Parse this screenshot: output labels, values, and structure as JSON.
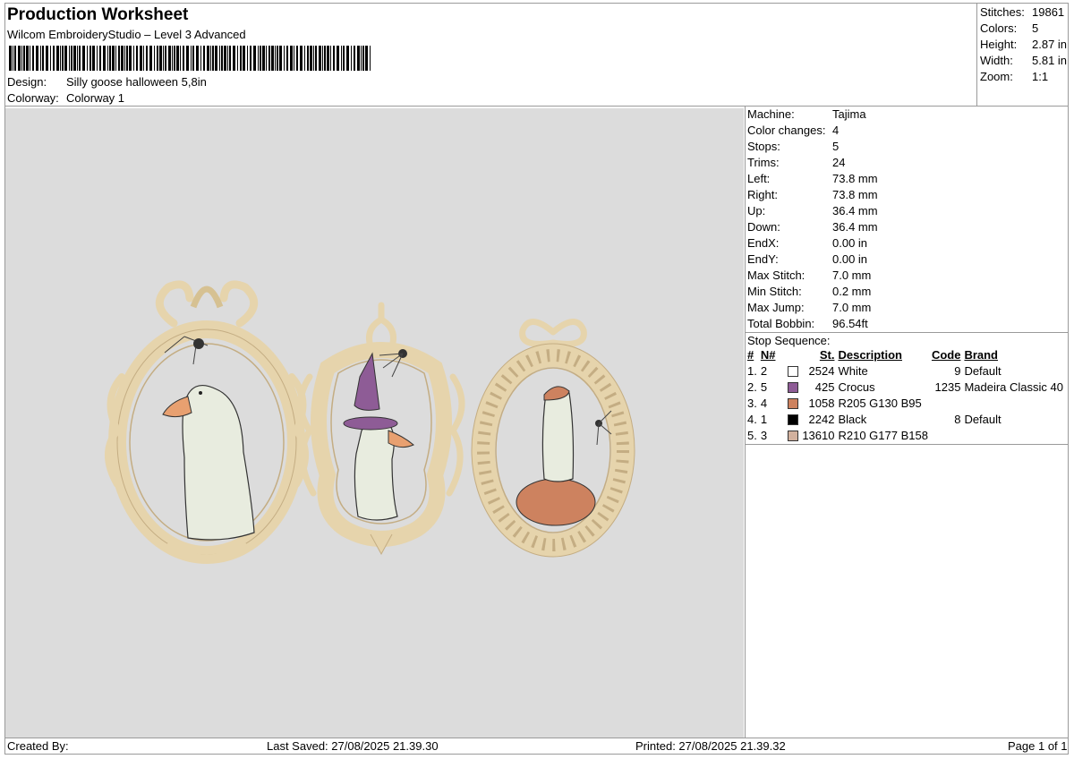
{
  "header": {
    "title": "Production Worksheet",
    "subtitle": "Wilcom EmbroideryStudio – Level 3 Advanced",
    "design_label": "Design:",
    "design_value": "Silly goose halloween 5,8in",
    "colorway_label": "Colorway:",
    "colorway_value": "Colorway 1"
  },
  "summary": [
    {
      "label": "Stitches:",
      "value": "19861"
    },
    {
      "label": "Colors:",
      "value": "5"
    },
    {
      "label": "Height:",
      "value": "2.87 in"
    },
    {
      "label": "Width:",
      "value": "5.81 in"
    },
    {
      "label": "Zoom:",
      "value": "1:1"
    }
  ],
  "machine": [
    {
      "label": "Machine:",
      "value": "Tajima"
    },
    {
      "label": "Color changes:",
      "value": "4"
    },
    {
      "label": "Stops:",
      "value": "5"
    },
    {
      "label": "Trims:",
      "value": "24"
    },
    {
      "label": "Left:",
      "value": "73.8 mm"
    },
    {
      "label": "Right:",
      "value": "73.8 mm"
    },
    {
      "label": "Up:",
      "value": "36.4 mm"
    },
    {
      "label": "Down:",
      "value": "36.4 mm"
    },
    {
      "label": "EndX:",
      "value": "0.00 in"
    },
    {
      "label": "EndY:",
      "value": "0.00 in"
    },
    {
      "label": "Max Stitch:",
      "value": "7.0 mm"
    },
    {
      "label": "Min Stitch:",
      "value": "0.2 mm"
    },
    {
      "label": "Max Jump:",
      "value": "7.0 mm"
    },
    {
      "label": "Total Bobbin:",
      "value": "96.54ft"
    }
  ],
  "stop_sequence": {
    "title": "Stop Sequence:",
    "headers": {
      "num": "#",
      "n": "N#",
      "st": "St.",
      "desc": "Description",
      "code": "Code",
      "brand": "Brand"
    },
    "rows": [
      {
        "num": "1.",
        "n": "2",
        "color": "#ffffff",
        "st": "2524",
        "desc": "White",
        "code": "9",
        "brand": "Default"
      },
      {
        "num": "2.",
        "n": "5",
        "color": "#8e5c96",
        "st": "425",
        "desc": "Crocus",
        "code": "1235",
        "brand": "Madeira Classic 40"
      },
      {
        "num": "3.",
        "n": "4",
        "color": "#cd825f",
        "st": "1058",
        "desc": "R205 G130 B95",
        "code": "",
        "brand": ""
      },
      {
        "num": "4.",
        "n": "1",
        "color": "#000000",
        "st": "2242",
        "desc": "Black",
        "code": "8",
        "brand": "Default"
      },
      {
        "num": "5.",
        "n": "3",
        "color": "#d2b19e",
        "st": "13610",
        "desc": "R210 G177 B158",
        "code": "",
        "brand": ""
      }
    ]
  },
  "footer": {
    "created_by": "Created By:",
    "last_saved": "Last Saved: 27/08/2025 21.39.30",
    "printed": "Printed: 27/08/2025 21.39.32",
    "page": "Page 1 of 1"
  },
  "colors": {
    "frame": "#e6d4ac",
    "frame_edge": "#c4ad83",
    "ghost": "#e8ecdf",
    "beak": "#e8a070",
    "hat": "#8e5c96",
    "pumpkin": "#cd825f",
    "canvas": "#dcdcdc"
  }
}
